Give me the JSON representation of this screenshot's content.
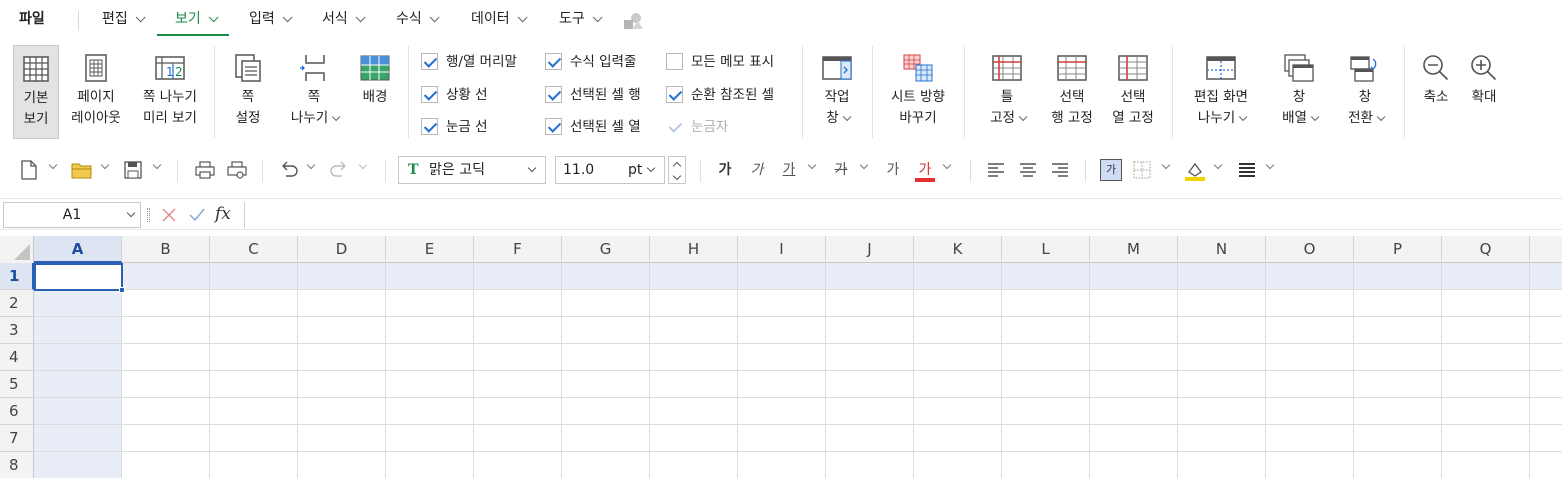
{
  "menu": {
    "items": [
      {
        "label": "파일"
      },
      {
        "label": "편집"
      },
      {
        "label": "보기"
      },
      {
        "label": "입력"
      },
      {
        "label": "서식"
      },
      {
        "label": "수식"
      },
      {
        "label": "데이터"
      },
      {
        "label": "도구"
      }
    ],
    "active_index": 2
  },
  "ribbon": {
    "buttons": [
      {
        "line1": "기본",
        "line2": "보기",
        "icon": "grid-view-icon",
        "active": true
      },
      {
        "line1": "페이지",
        "line2": "레이아웃",
        "icon": "page-layout-icon"
      },
      {
        "line1": "쪽 나누기",
        "line2": "미리 보기",
        "icon": "page-break-preview-icon"
      },
      {
        "line1": "쪽",
        "line2": "설정",
        "icon": "page-setup-icon"
      },
      {
        "line1": "쪽",
        "line2": "나누기",
        "icon": "page-break-icon"
      },
      {
        "line1": "배경",
        "line2": "",
        "icon": "background-icon"
      },
      {
        "line1": "작업",
        "line2": "창",
        "icon": "task-pane-icon"
      },
      {
        "line1": "시트 방향",
        "line2": "바꾸기",
        "icon": "sheet-direction-icon"
      },
      {
        "line1": "틀",
        "line2": "고정",
        "icon": "freeze-panes-icon"
      },
      {
        "line1": "선택",
        "line2": "행 고정",
        "icon": "freeze-row-icon"
      },
      {
        "line1": "선택",
        "line2": "열 고정",
        "icon": "freeze-column-icon"
      },
      {
        "line1": "편집 화면",
        "line2": "나누기",
        "icon": "split-view-icon"
      },
      {
        "line1": "창",
        "line2": "배열",
        "icon": "arrange-windows-icon"
      },
      {
        "line1": "창",
        "line2": "전환",
        "icon": "switch-window-icon"
      },
      {
        "line1": "축소",
        "line2": "",
        "icon": "zoom-out-icon"
      },
      {
        "line1": "확대",
        "line2": "",
        "icon": "zoom-in-icon"
      }
    ],
    "checkboxes": [
      {
        "label": "행/열 머리말",
        "checked": true
      },
      {
        "label": "상황 선",
        "checked": true
      },
      {
        "label": "눈금 선",
        "checked": true
      },
      {
        "label": "수식 입력줄",
        "checked": true
      },
      {
        "label": "선택된 셀 행",
        "checked": true
      },
      {
        "label": "선택된 셀 열",
        "checked": true
      },
      {
        "label": "모든 메모 표시",
        "checked": false
      },
      {
        "label": "순환 참조된 셀",
        "checked": true
      },
      {
        "label": "눈금자",
        "checked": true,
        "disabled": true
      }
    ]
  },
  "toolbar": {
    "font_name": "맑은 고딕",
    "font_size": "11.0",
    "font_unit": "pt",
    "bold_glyph": "가",
    "italic_glyph": "가",
    "underline_glyph": "가",
    "strike_glyph": "가",
    "shadow_glyph": "가",
    "color_glyph": "가",
    "cell_glyph": "가"
  },
  "formula_bar": {
    "cell_ref": "A1",
    "fx_label": "fx",
    "value": ""
  },
  "grid": {
    "columns": [
      "A",
      "B",
      "C",
      "D",
      "E",
      "F",
      "G",
      "H",
      "I",
      "J",
      "K",
      "L",
      "M",
      "N",
      "O",
      "P",
      "Q"
    ],
    "rows": [
      "1",
      "2",
      "3",
      "4",
      "5",
      "6",
      "7",
      "8"
    ],
    "selected_col": "A",
    "selected_row": "1"
  },
  "colors": {
    "accent": "#1a8b48",
    "selection": "#2a5fb6",
    "selection_fill": "#e8edf7"
  }
}
